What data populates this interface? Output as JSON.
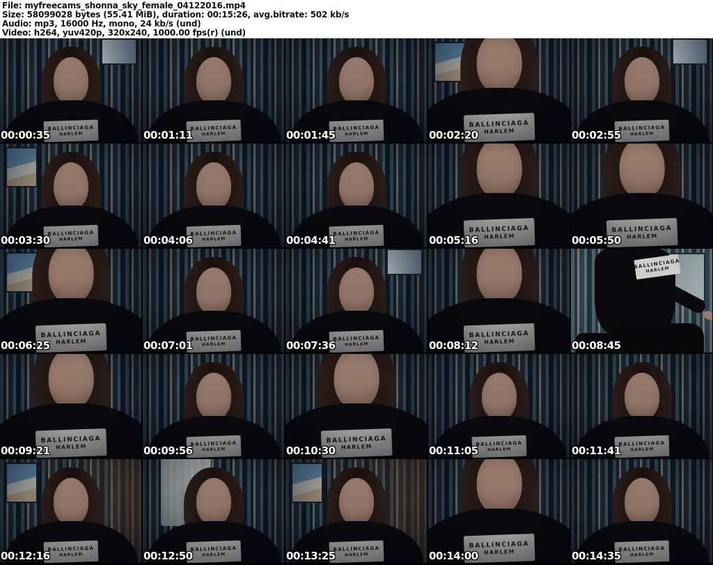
{
  "header": {
    "lines": [
      "File: myfreecams_shonna_sky_female_04122016.mp4",
      "Size: 58099028 bytes (55.41 MiB), duration: 00:15:26, avg.bitrate: 502 kb/s",
      "Audio: mp3, 16000 Hz, mono, 24 kb/s (und)",
      "Video: h264, yuv420p, 320x240, 1000.00 fps(r) (und)"
    ]
  },
  "clothing_label": {
    "line1": "BALLINCIAGA",
    "line2": "HARLEM"
  },
  "grid": {
    "columns": 5,
    "rows": 5,
    "thumbnails": [
      {
        "time": "00:00:35",
        "variant": "window-right"
      },
      {
        "time": "00:01:11",
        "variant": ""
      },
      {
        "time": "00:01:45",
        "variant": ""
      },
      {
        "time": "00:02:20",
        "variant": "close picture-left"
      },
      {
        "time": "00:02:55",
        "variant": "window-right"
      },
      {
        "time": "00:03:30",
        "variant": "picture-left"
      },
      {
        "time": "00:04:06",
        "variant": ""
      },
      {
        "time": "00:04:41",
        "variant": ""
      },
      {
        "time": "00:05:16",
        "variant": "close"
      },
      {
        "time": "00:05:50",
        "variant": "close"
      },
      {
        "time": "00:06:25",
        "variant": "close picture-left"
      },
      {
        "time": "00:07:01",
        "variant": ""
      },
      {
        "time": "00:07:36",
        "variant": "window-right"
      },
      {
        "time": "00:08:12",
        "variant": "close"
      },
      {
        "time": "00:08:45",
        "variant": "standing"
      },
      {
        "time": "00:09:21",
        "variant": "close"
      },
      {
        "time": "00:09:56",
        "variant": ""
      },
      {
        "time": "00:10:30",
        "variant": "close"
      },
      {
        "time": "00:11:05",
        "variant": ""
      },
      {
        "time": "00:11:41",
        "variant": ""
      },
      {
        "time": "00:12:16",
        "variant": "picture-left warm"
      },
      {
        "time": "00:12:50",
        "variant": "bright-left"
      },
      {
        "time": "00:13:25",
        "variant": "picture-left warm"
      },
      {
        "time": "00:14:00",
        "variant": "close"
      },
      {
        "time": "00:14:35",
        "variant": ""
      }
    ]
  },
  "colors": {
    "header_bg": "#ffffff",
    "header_text": "#111111",
    "canvas_bg": "#000000",
    "timestamp_text": "#ffffff",
    "wallpaper_teal": "#3b5a64",
    "wallpaper_beige": "#8d8878",
    "sweatshirt": "#0b0b0f",
    "tag_bg": "#f1efe8"
  }
}
